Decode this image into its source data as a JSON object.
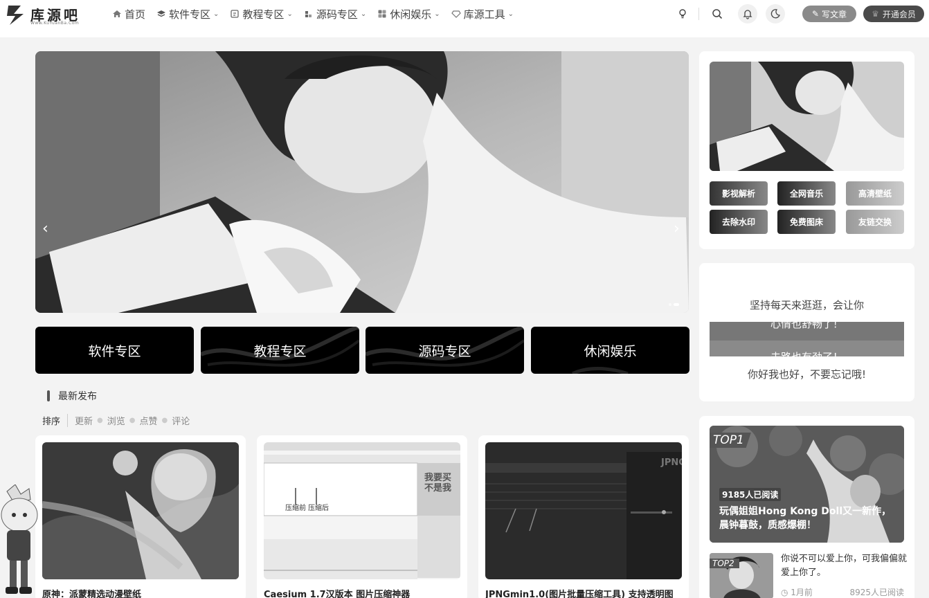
{
  "header": {
    "logo_text": "库源吧",
    "logo_sub": "Www.KuYuanBa.Com",
    "nav": [
      {
        "label": "首页",
        "icon": "home-icon",
        "dropdown": false
      },
      {
        "label": "软件专区",
        "icon": "layers-icon",
        "dropdown": true
      },
      {
        "label": "教程专区",
        "icon": "book-icon",
        "dropdown": true
      },
      {
        "label": "源码专区",
        "icon": "code-icon",
        "dropdown": true
      },
      {
        "label": "休闲娱乐",
        "icon": "grid-icon",
        "dropdown": true
      },
      {
        "label": "库源工具",
        "icon": "diamond-icon",
        "dropdown": true
      }
    ],
    "write_label": "写文章",
    "vip_label": "开通会员"
  },
  "categories": [
    "软件专区",
    "教程专区",
    "源码专区",
    "休闲娱乐"
  ],
  "latest": {
    "title": "最新发布",
    "sort_label": "排序",
    "sort_options": [
      "更新",
      "浏览",
      "点赞",
      "评论"
    ]
  },
  "posts": [
    {
      "title": "原神：派蒙精选动漫壁纸"
    },
    {
      "title": "Caesium 1.7汉版本 图片压缩神器",
      "annot_1": "压缩前",
      "annot_2": "压缩后",
      "banner_text": "我要买不是我"
    },
    {
      "title": "JPNGmin1.0(图片批量压缩工具) 支持透明图",
      "brand": "JPNG"
    }
  ],
  "sidebar": {
    "quick_buttons": [
      "影视解析",
      "全网音乐",
      "高清壁纸",
      "去除水印",
      "免费图床",
      "友链交换"
    ],
    "motto_1": "坚持每天来逛逛，会让你",
    "motto_scroll_1": "心情也舒畅了！",
    "motto_scroll_2": "去路也有劲了！",
    "motto_2": "你好我也好，不要忘记哦!",
    "top1": {
      "tag": "TOP1",
      "reads": "9185人已阅读",
      "title": "玩偶姐姐Hong Kong Doll又一新作，晨钟暮鼓，质感爆棚！"
    },
    "top2": {
      "tag": "TOP2",
      "title": "你说不可以爱上你，可我偏偏就爱上你了。",
      "time": "1月前",
      "reads": "8925人已阅读"
    }
  }
}
